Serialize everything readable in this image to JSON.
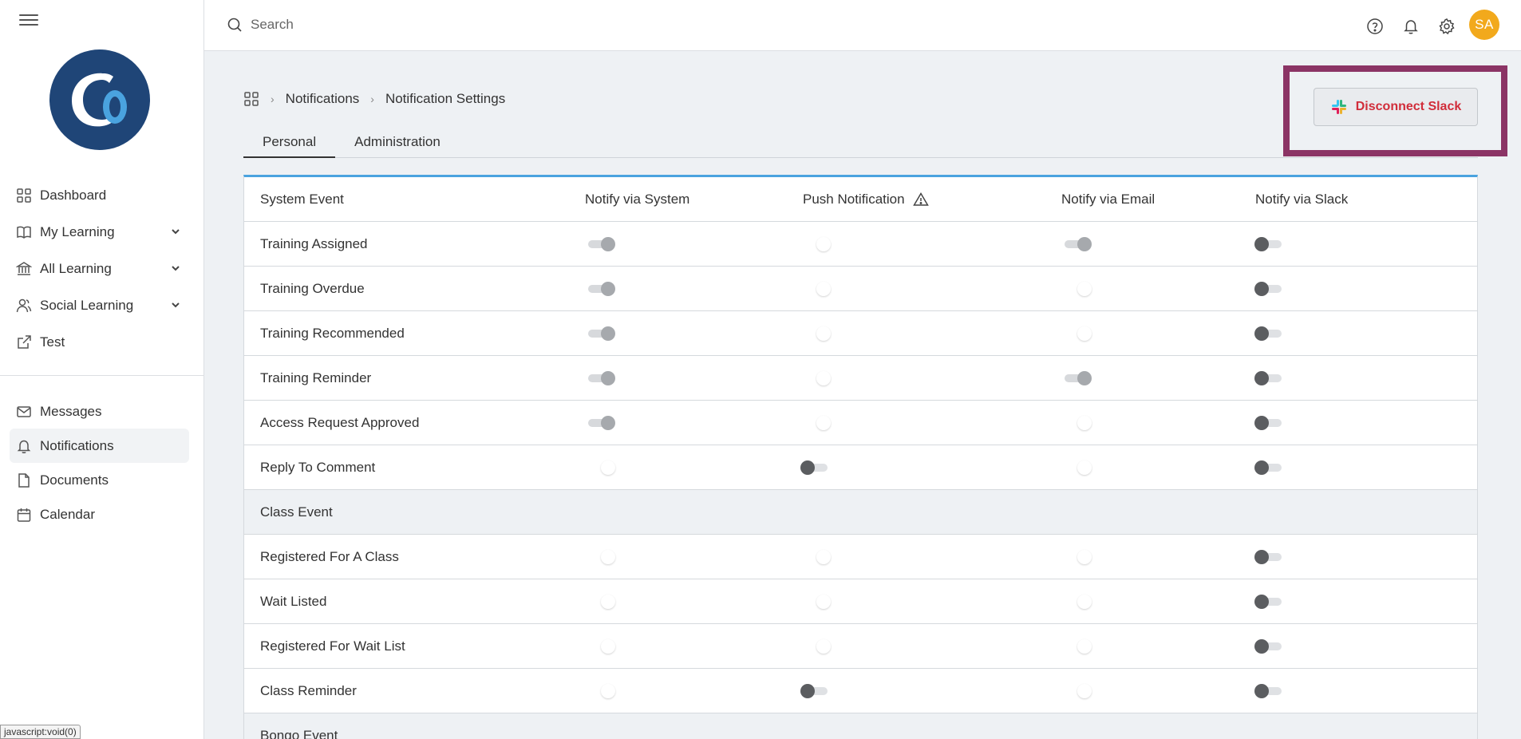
{
  "search": {
    "placeholder": "Search"
  },
  "user": {
    "initials": "SA"
  },
  "sidebar": {
    "main_items": [
      {
        "label": "Dashboard"
      },
      {
        "label": "My Learning"
      },
      {
        "label": "All Learning"
      },
      {
        "label": "Social Learning"
      },
      {
        "label": "Test"
      }
    ],
    "secondary_items": [
      {
        "label": "Messages"
      },
      {
        "label": "Notifications"
      },
      {
        "label": "Documents"
      },
      {
        "label": "Calendar"
      }
    ]
  },
  "status_bar": "javascript:void(0)",
  "breadcrumb": {
    "item1": "Notifications",
    "item2": "Notification Settings"
  },
  "tabs": [
    {
      "label": "Personal"
    },
    {
      "label": "Administration"
    }
  ],
  "slack_button": {
    "label": "Disconnect Slack"
  },
  "colors": {
    "accent": "#4aa3df",
    "brand": "#1f4577",
    "avatar": "#f2a91c",
    "slack_label": "#d12d3a",
    "highlight": "#8b3465"
  },
  "table": {
    "columns": [
      "System Event",
      "Notify via System",
      "Push Notification",
      "Notify via Email",
      "Notify via Slack"
    ],
    "rows": [
      {
        "label": "Training Assigned",
        "toggles": [
          "on",
          "off",
          "on",
          "dark"
        ]
      },
      {
        "label": "Training Overdue",
        "toggles": [
          "on",
          "off",
          "off",
          "dark"
        ]
      },
      {
        "label": "Training Recommended",
        "toggles": [
          "on",
          "off",
          "off",
          "dark"
        ]
      },
      {
        "label": "Training Reminder",
        "toggles": [
          "on",
          "off",
          "on",
          "dark"
        ]
      },
      {
        "label": "Access Request Approved",
        "toggles": [
          "on",
          "off",
          "off",
          "dark"
        ]
      },
      {
        "label": "Reply To Comment",
        "toggles": [
          "off",
          "dark",
          "off",
          "dark"
        ]
      },
      {
        "label": "Class Event",
        "section": true
      },
      {
        "label": "Registered For A Class",
        "toggles": [
          "off",
          "off",
          "off",
          "dark"
        ]
      },
      {
        "label": "Wait Listed",
        "toggles": [
          "off",
          "off",
          "off",
          "dark"
        ]
      },
      {
        "label": "Registered For Wait List",
        "toggles": [
          "off",
          "off",
          "off",
          "dark"
        ]
      },
      {
        "label": "Class Reminder",
        "toggles": [
          "off",
          "dark",
          "off",
          "dark"
        ]
      },
      {
        "label": "Bongo Event",
        "section": true
      }
    ]
  }
}
